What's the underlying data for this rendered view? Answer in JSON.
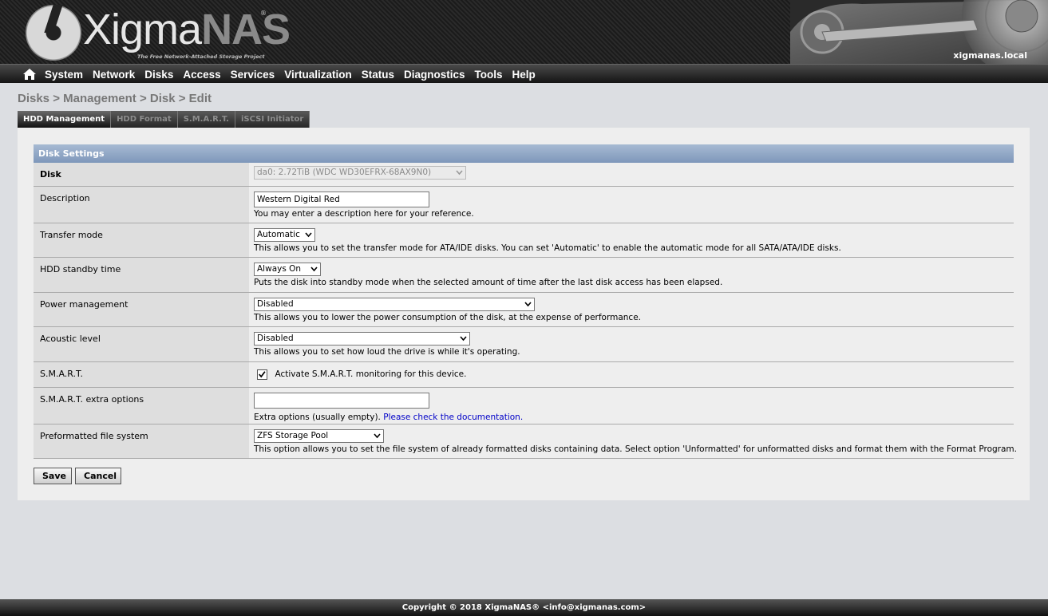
{
  "header": {
    "logo": {
      "prefix": "Xigma",
      "suffix": "NAS",
      "reg": "®",
      "tagline": "The Free Network-Attached Storage Project"
    },
    "hostname": "xigmanas.local"
  },
  "nav": {
    "home_icon": "home-icon",
    "items": [
      "System",
      "Network",
      "Disks",
      "Access",
      "Services",
      "Virtualization",
      "Status",
      "Diagnostics",
      "Tools",
      "Help"
    ]
  },
  "breadcrumb": "Disks > Management > Disk > Edit",
  "tabs": [
    {
      "label": "HDD Management",
      "active": true
    },
    {
      "label": "HDD Format",
      "active": false
    },
    {
      "label": "S.M.A.R.T.",
      "active": false
    },
    {
      "label": "iSCSI Initiator",
      "active": false
    }
  ],
  "section": {
    "title": "Disk Settings"
  },
  "form": {
    "disk": {
      "label": "Disk",
      "value": "da0: 2.72TiB (WDC WD30EFRX-68AX9N0)",
      "disabled": true
    },
    "description": {
      "label": "Description",
      "value": "Western Digital Red",
      "help": "You may enter a description here for your reference."
    },
    "transfer_mode": {
      "label": "Transfer mode",
      "value": "Automatic",
      "help": "This allows you to set the transfer mode for ATA/IDE disks. You can set 'Automatic' to enable the automatic mode for all SATA/ATA/IDE disks."
    },
    "standby": {
      "label": "HDD standby time",
      "value": "Always On",
      "help": "Puts the disk into standby mode when the selected amount of time after the last disk access has been elapsed."
    },
    "power": {
      "label": "Power management",
      "value": "Disabled",
      "help": "This allows you to lower the power consumption of the disk, at the expense of performance."
    },
    "acoustic": {
      "label": "Acoustic level",
      "value": "Disabled",
      "help": "This allows you to set how loud the drive is while it's operating."
    },
    "smart": {
      "label": "S.M.A.R.T.",
      "checked": true,
      "checkbox_label": "Activate S.M.A.R.T. monitoring for this device."
    },
    "smart_extra": {
      "label": "S.M.A.R.T. extra options",
      "value": "",
      "help": "Extra options (usually empty).",
      "link": "Please check the documentation."
    },
    "fs": {
      "label": "Preformatted file system",
      "value": "ZFS Storage Pool",
      "help": "This option allows you to set the file system of already formatted disks containing data. Select option 'Unformatted' for unformatted disks and format them with the Format Program."
    }
  },
  "buttons": {
    "save": "Save",
    "cancel": "Cancel"
  },
  "footer": {
    "copyright": "Copyright © 2018 XigmaNAS®",
    "email": "<info@xigmanas.com>"
  },
  "colors": {
    "section_header": "#8ea4c4",
    "link": "#0000c8",
    "breadcrumb": "#777777"
  }
}
